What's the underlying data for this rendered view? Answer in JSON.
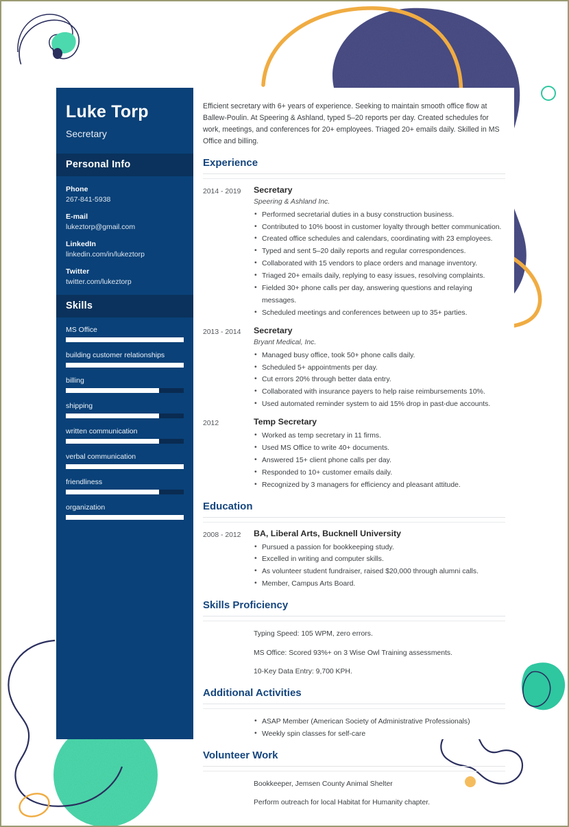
{
  "colors": {
    "sidebar_bg": "#0a4178",
    "sidebar_band_bg": "#0a325c",
    "bar_track": "#0a2b51",
    "bar_fill": "#ffffff",
    "heading_navy": "#14457e",
    "decor_navy": "#4a4e86",
    "decor_navy_line": "#2b2f5e",
    "decor_teal": "#3fd6a8",
    "decor_orange": "#f0a93c",
    "page_border": "#9a9a72"
  },
  "sidebar": {
    "name": "Luke Torp",
    "job_title": "Secretary",
    "personal_info": {
      "heading": "Personal Info",
      "items": [
        {
          "label": "Phone",
          "value": "267-841-5938"
        },
        {
          "label": "E-mail",
          "value": "lukeztorp@gmail.com"
        },
        {
          "label": "LinkedIn",
          "value": "linkedin.com/in/lukeztorp"
        },
        {
          "label": "Twitter",
          "value": "twitter.com/lukeztorp"
        }
      ]
    },
    "skills": {
      "heading": "Skills",
      "items": [
        {
          "name": "MS Office",
          "level": 100
        },
        {
          "name": "building customer relationships",
          "level": 100
        },
        {
          "name": "billing",
          "level": 79
        },
        {
          "name": "shipping",
          "level": 79
        },
        {
          "name": "written communication",
          "level": 79
        },
        {
          "name": "verbal communication",
          "level": 100
        },
        {
          "name": "friendliness",
          "level": 79
        },
        {
          "name": "organization",
          "level": 100
        }
      ]
    }
  },
  "main": {
    "summary": "Efficient secretary with 6+ years of experience. Seeking to maintain smooth office flow at Ballew-Poulin. At Speering & Ashland, typed 5–20 reports per day. Created schedules for work, meetings, and conferences for 20+ employees. Triaged 20+ emails daily. Skilled in MS Office and billing.",
    "experience": {
      "heading": "Experience",
      "entries": [
        {
          "date": "2014 - 2019",
          "role": "Secretary",
          "org": "Speering & Ashland Inc.",
          "bullets": [
            "Performed secretarial duties in a busy construction business.",
            "Contributed to 10% boost in customer loyalty through better communication.",
            "Created office schedules and calendars, coordinating with 23 employees.",
            "Typed and sent 5–20 daily reports and regular correspondences.",
            "Collaborated with 15 vendors to place orders and manage inventory.",
            "Triaged 20+ emails daily, replying to easy issues, resolving complaints.",
            "Fielded 30+ phone calls per day, answering questions and relaying messages.",
            "Scheduled meetings and conferences between up to 35+ parties."
          ]
        },
        {
          "date": "2013 - 2014",
          "role": "Secretary",
          "org": "Bryant Medical, Inc.",
          "bullets": [
            "Managed busy office, took 50+ phone calls daily.",
            "Scheduled 5+ appointments per day.",
            "Cut errors 20% through better data entry.",
            "Collaborated with insurance payers to help raise reimbursements 10%.",
            "Used automated reminder system to aid 15% drop in past-due accounts."
          ]
        },
        {
          "date": "2012",
          "role": "Temp Secretary",
          "org": "",
          "bullets": [
            "Worked as temp secretary in 11 firms.",
            "Used MS Office to write 40+ documents.",
            "Answered 15+ client phone calls per day.",
            "Responded to 10+ customer emails daily.",
            "Recognized by 3 managers for efficiency and pleasant attitude."
          ]
        }
      ]
    },
    "education": {
      "heading": "Education",
      "entries": [
        {
          "date": "2008 - 2012",
          "degree": "BA, Liberal Arts, Bucknell University",
          "bullets": [
            "Pursued a passion for bookkeeping study.",
            "Excelled in writing and computer skills.",
            "As volunteer student fundraiser, raised $20,000 through alumni calls.",
            "Member, Campus Arts Board."
          ]
        }
      ]
    },
    "skills_proficiency": {
      "heading": "Skills Proficiency",
      "lines": [
        "Typing Speed: 105 WPM, zero errors.",
        "MS Office: Scored 93%+ on 3 Wise Owl Training assessments.",
        "10-Key Data Entry: 9,700 KPH."
      ]
    },
    "additional_activities": {
      "heading": "Additional Activities",
      "bullets": [
        "ASAP Member (American Society of Administrative Professionals)",
        "Weekly spin classes for self-care"
      ]
    },
    "volunteer_work": {
      "heading": "Volunteer Work",
      "lines": [
        "Bookkeeper, Jemsen County Animal Shelter",
        "Perform outreach for local Habitat for Humanity chapter."
      ]
    }
  }
}
